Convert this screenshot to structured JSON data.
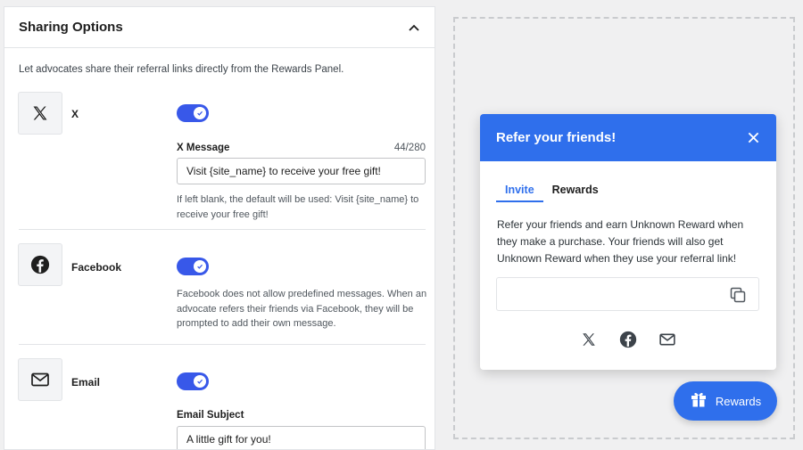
{
  "panel": {
    "title": "Sharing Options",
    "intro": "Let advocates share their referral links directly from the Rewards Panel."
  },
  "networks": {
    "x": {
      "label": "X",
      "enabled": true,
      "field_label": "X Message",
      "char_count": "44/280",
      "value": "Visit {site_name} to receive your free gift!",
      "help": "If left blank, the default will be used: Visit {site_name} to receive your free gift!"
    },
    "facebook": {
      "label": "Facebook",
      "enabled": true,
      "help": "Facebook does not allow predefined messages. When an advocate refers their friends via Facebook, they will be prompted to add their own message."
    },
    "email": {
      "label": "Email",
      "enabled": true,
      "field_label": "Email Subject",
      "value": "A little gift for you!"
    }
  },
  "widget": {
    "title": "Refer your friends!",
    "tabs": [
      "Invite",
      "Rewards"
    ],
    "active_tab": "Invite",
    "text": "Refer your friends and earn Unknown Reward when they make a purchase. Your friends will also get Unknown Reward when they use your referral link!",
    "share_icons": [
      "x-icon",
      "facebook-icon",
      "email-icon"
    ]
  },
  "launcher": {
    "label": "Rewards",
    "icon": "gift-icon"
  },
  "colors": {
    "accent": "#2f6fec",
    "toggle_on": "#3858e9"
  }
}
